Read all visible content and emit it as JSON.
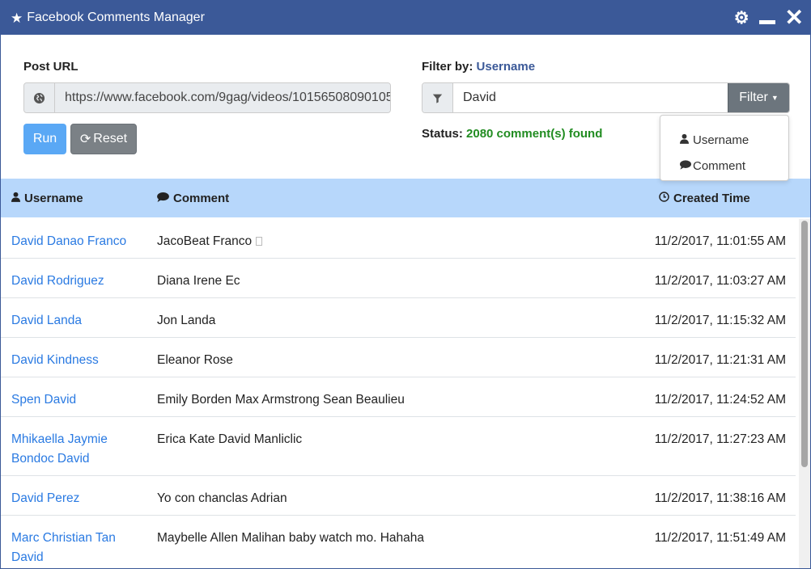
{
  "window": {
    "title": "Facebook Comments Manager",
    "accent": "#3b5998"
  },
  "post_url": {
    "label": "Post URL",
    "value": "https://www.facebook.com/9gag/videos/10156508090105"
  },
  "buttons": {
    "run": "Run",
    "reset": "Reset"
  },
  "filter": {
    "label": "Filter by:",
    "selected": "Username",
    "value": "David",
    "button": "Filter",
    "options": [
      "Username",
      "Comment"
    ]
  },
  "status": {
    "label": "Status:",
    "value": "2080 comment(s) found",
    "color": "#218c21"
  },
  "table": {
    "headers": {
      "username": "Username",
      "comment": "Comment",
      "time": "Created Time"
    },
    "rows": [
      {
        "username": "David Danao Franco",
        "comment": "JacoBeat Franco",
        "time": "11/2/2017, 11:01:55 AM"
      },
      {
        "username": "David Rodriguez",
        "comment": "Diana Irene Ec",
        "time": "11/2/2017, 11:03:27 AM"
      },
      {
        "username": "David Landa",
        "comment": "Jon Landa",
        "time": "11/2/2017, 11:15:32 AM"
      },
      {
        "username": "David Kindness",
        "comment": "Eleanor Rose",
        "time": "11/2/2017, 11:21:31 AM"
      },
      {
        "username": "Spen David",
        "comment": "Emily Borden Max Armstrong Sean Beaulieu",
        "time": "11/2/2017, 11:24:52 AM"
      },
      {
        "username": "Mhikaella Jaymie Bondoc David",
        "comment": "Erica Kate David Manliclic",
        "time": "11/2/2017, 11:27:23 AM"
      },
      {
        "username": "David Perez",
        "comment": "Yo con chanclas Adrian",
        "time": "11/2/2017, 11:38:16 AM"
      },
      {
        "username": "Marc Christian Tan David",
        "comment": "Maybelle Allen Malihan baby watch mo. Hahaha",
        "time": "11/2/2017, 11:51:49 AM"
      }
    ]
  }
}
